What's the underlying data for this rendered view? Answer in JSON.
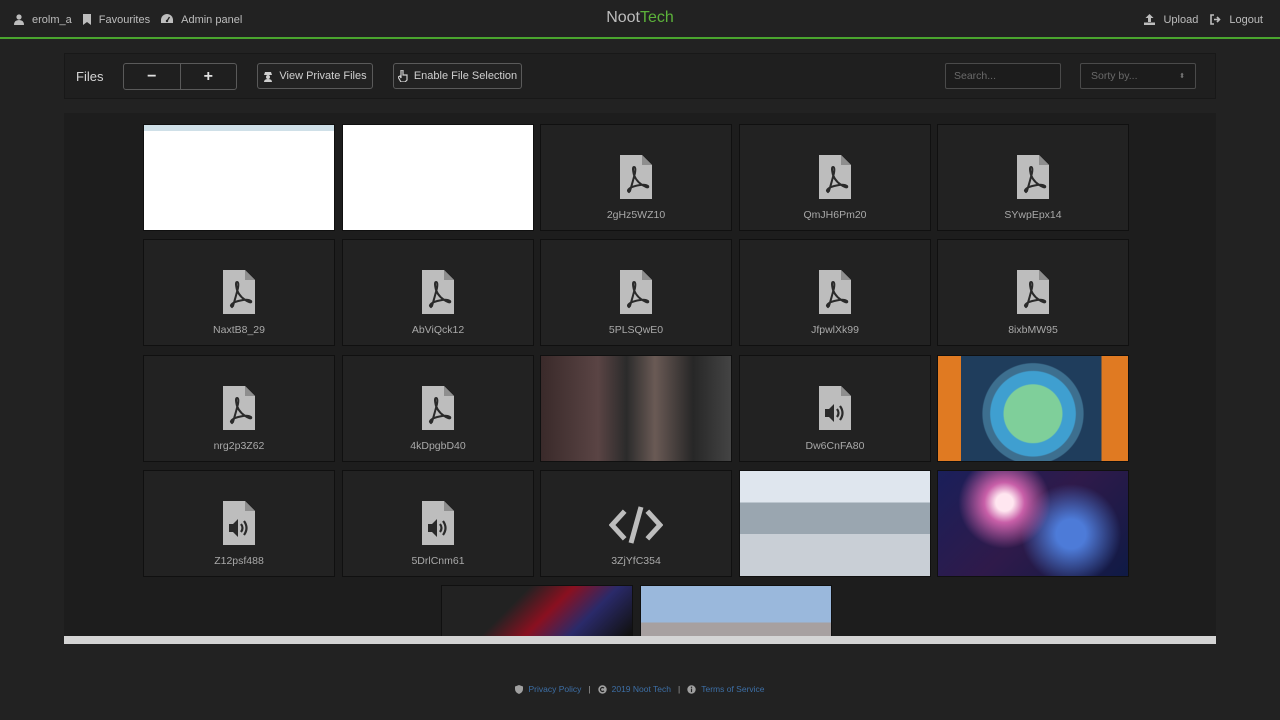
{
  "nav": {
    "username": "erolm_a",
    "favourites": "Favourites",
    "admin": "Admin panel",
    "brand_part1": "Noot",
    "brand_part2": "Tech",
    "upload": "Upload",
    "logout": "Logout"
  },
  "toolbar": {
    "title": "Files",
    "zoom_out": "−",
    "zoom_in": "+",
    "view_private": "View Private Files",
    "enable_selection": "Enable File Selection",
    "search_placeholder": "Search...",
    "sort_placeholder": "Sorty by..."
  },
  "files": [
    {
      "name": "",
      "kind": "image",
      "thumb": "doc1"
    },
    {
      "name": "",
      "kind": "image",
      "thumb": "doc2"
    },
    {
      "name": "2gHz5WZ10",
      "kind": "pdf"
    },
    {
      "name": "QmJH6Pm20",
      "kind": "pdf"
    },
    {
      "name": "SYwpEpx14",
      "kind": "pdf"
    },
    {
      "name": "NaxtB8_29",
      "kind": "pdf"
    },
    {
      "name": "AbViQck12",
      "kind": "pdf"
    },
    {
      "name": "5PLSQwE0",
      "kind": "pdf"
    },
    {
      "name": "JfpwlXk99",
      "kind": "pdf"
    },
    {
      "name": "8ixbMW95",
      "kind": "pdf"
    },
    {
      "name": "nrg2p3Z62",
      "kind": "pdf"
    },
    {
      "name": "4kDpgbD40",
      "kind": "pdf"
    },
    {
      "name": "",
      "kind": "image",
      "thumb": "poster"
    },
    {
      "name": "Dw6CnFA80",
      "kind": "audio"
    },
    {
      "name": "",
      "kind": "image",
      "thumb": "fragile"
    },
    {
      "name": "Z12psf488",
      "kind": "audio"
    },
    {
      "name": "5DrlCnm61",
      "kind": "audio"
    },
    {
      "name": "3ZjYfC354",
      "kind": "code"
    },
    {
      "name": "",
      "kind": "image",
      "thumb": "person"
    },
    {
      "name": "",
      "kind": "image",
      "thumb": "space"
    },
    {
      "name": "",
      "kind": "image",
      "thumb": "chat"
    },
    {
      "name": "",
      "kind": "image",
      "thumb": "building"
    }
  ],
  "footer": {
    "privacy": "Privacy Policy",
    "copyright": "2019 Noot Tech",
    "terms": "Terms of Service"
  },
  "colors": {
    "accent_green": "#5cb23a",
    "navbar_border": "#4aa52e",
    "link_blue": "#3d6fa6",
    "background": "#222222"
  }
}
